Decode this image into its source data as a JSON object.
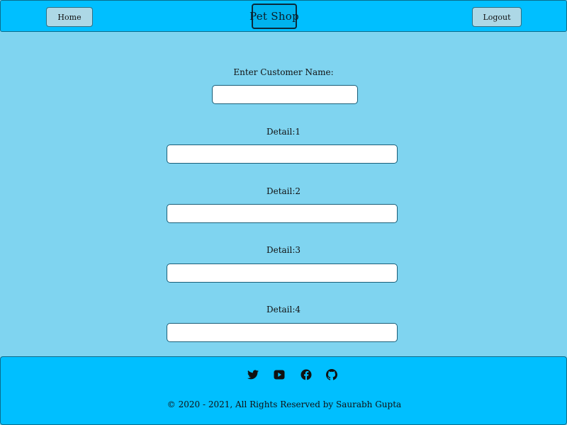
{
  "header": {
    "home_label": "Home",
    "logo_text": "Pet Shop",
    "logout_label": "Logout"
  },
  "form": {
    "customer_name_label": "Enter Customer Name:",
    "customer_name_value": "",
    "details": [
      {
        "label": "Detail:1",
        "value": ""
      },
      {
        "label": "Detail:2",
        "value": ""
      },
      {
        "label": "Detail:3",
        "value": ""
      },
      {
        "label": "Detail:4",
        "value": ""
      }
    ]
  },
  "footer": {
    "social_icons": [
      "twitter-icon",
      "youtube-icon",
      "facebook-icon",
      "github-icon"
    ],
    "copyright": "© 2020 - 2021, All Rights Reserved by Saurabh Gupta"
  },
  "colors": {
    "header_bg": "#00bfff",
    "page_bg": "#7fd4f0",
    "button_bg": "#add8e6"
  }
}
